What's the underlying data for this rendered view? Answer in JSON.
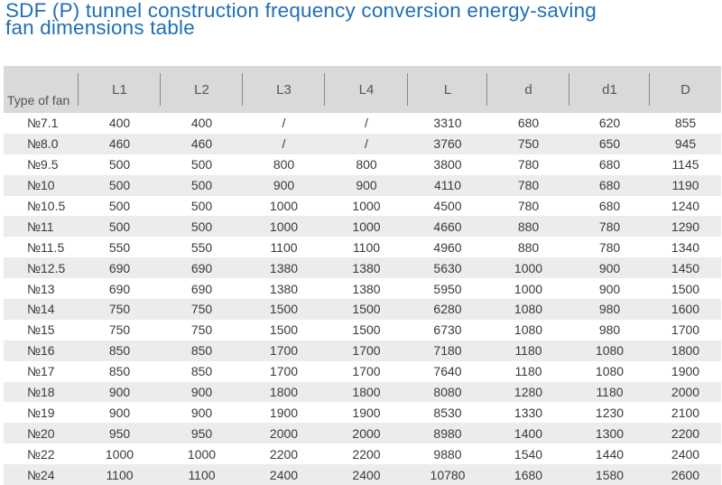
{
  "title_line1": "SDF (P) tunnel construction frequency conversion energy-saving",
  "title_line2": "fan dimensions table",
  "headers": [
    "Type of fan",
    "L1",
    "L2",
    "L3",
    "L4",
    "L",
    "d",
    "d1",
    "D"
  ],
  "rows": [
    [
      "№7.1",
      "400",
      "400",
      "/",
      "/",
      "3310",
      "680",
      "620",
      "855"
    ],
    [
      "№8.0",
      "460",
      "460",
      "/",
      "/",
      "3760",
      "750",
      "650",
      "945"
    ],
    [
      "№9.5",
      "500",
      "500",
      "800",
      "800",
      "3800",
      "780",
      "680",
      "1145"
    ],
    [
      "№10",
      "500",
      "500",
      "900",
      "900",
      "4110",
      "780",
      "680",
      "1190"
    ],
    [
      "№10.5",
      "500",
      "500",
      "1000",
      "1000",
      "4500",
      "780",
      "680",
      "1240"
    ],
    [
      "№11",
      "500",
      "500",
      "1000",
      "1000",
      "4660",
      "880",
      "780",
      "1290"
    ],
    [
      "№11.5",
      "550",
      "550",
      "1100",
      "1100",
      "4960",
      "880",
      "780",
      "1340"
    ],
    [
      "№12.5",
      "690",
      "690",
      "1380",
      "1380",
      "5630",
      "1000",
      "900",
      "1450"
    ],
    [
      "№13",
      "690",
      "690",
      "1380",
      "1380",
      "5950",
      "1000",
      "900",
      "1500"
    ],
    [
      "№14",
      "750",
      "750",
      "1500",
      "1500",
      "6280",
      "1080",
      "980",
      "1600"
    ],
    [
      "№15",
      "750",
      "750",
      "1500",
      "1500",
      "6730",
      "1080",
      "980",
      "1700"
    ],
    [
      "№16",
      "850",
      "850",
      "1700",
      "1700",
      "7180",
      "1180",
      "1080",
      "1800"
    ],
    [
      "№17",
      "850",
      "850",
      "1700",
      "1700",
      "7640",
      "1180",
      "1080",
      "1900"
    ],
    [
      "№18",
      "900",
      "900",
      "1800",
      "1800",
      "8080",
      "1280",
      "1180",
      "2000"
    ],
    [
      "№19",
      "900",
      "900",
      "1900",
      "1900",
      "8530",
      "1330",
      "1230",
      "2100"
    ],
    [
      "№20",
      "950",
      "950",
      "2000",
      "2000",
      "8980",
      "1400",
      "1300",
      "2200"
    ],
    [
      "№22",
      "1000",
      "1000",
      "2200",
      "2200",
      "9880",
      "1540",
      "1440",
      "2400"
    ],
    [
      "№24",
      "1100",
      "1100",
      "2400",
      "2400",
      "10780",
      "1680",
      "1580",
      "2600"
    ]
  ],
  "colors": {
    "title": "#1f6fb4",
    "header_bg": "#d9d9d9",
    "stripe": "#ececec",
    "text": "#3a3a3a"
  }
}
